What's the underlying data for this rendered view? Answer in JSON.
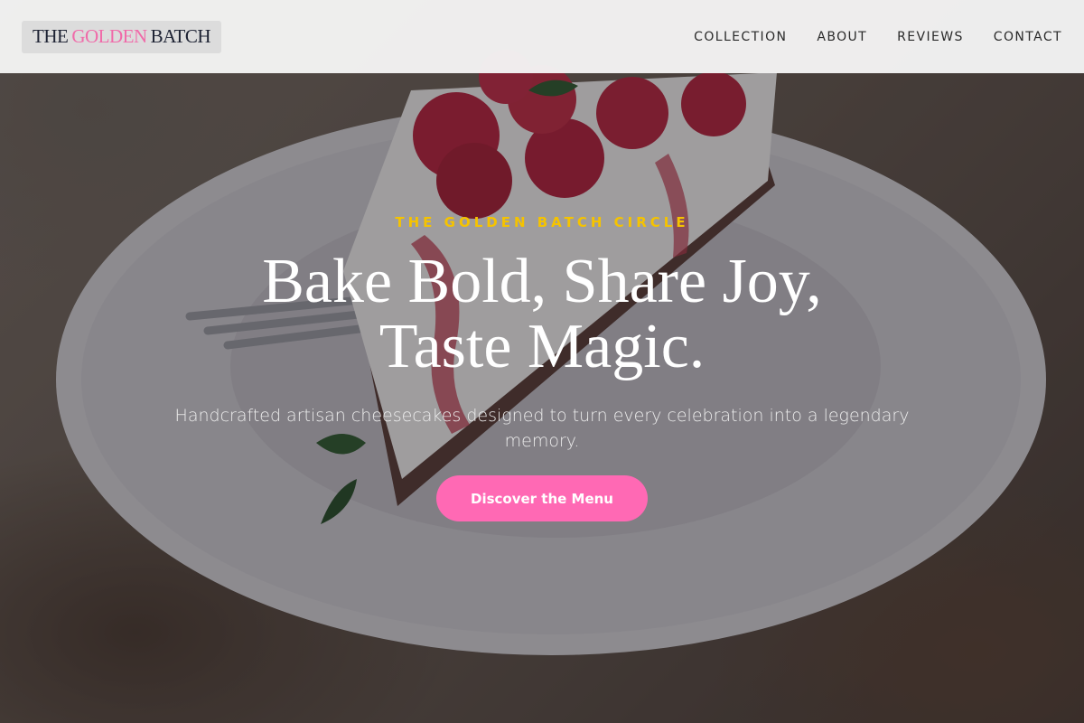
{
  "header": {
    "logo": {
      "part1": "THE",
      "part2": "GOLDEN",
      "part3": "BATCH"
    },
    "nav": [
      {
        "label": "COLLECTION"
      },
      {
        "label": "ABOUT"
      },
      {
        "label": "REVIEWS"
      },
      {
        "label": "CONTACT"
      }
    ]
  },
  "hero": {
    "eyebrow": "THE GOLDEN BATCH CIRCLE",
    "headline_line1": "Bake Bold, Share Joy,",
    "headline_line2": "Taste Magic.",
    "subtitle": "Handcrafted artisan cheesecakes designed to turn every celebration into a legendary memory.",
    "cta_label": "Discover the Menu"
  },
  "colors": {
    "accent_pink": "#ff69b4",
    "logo_pink": "#f06aa9",
    "eyebrow_gold": "#f5c300",
    "header_bg": "#f5f5f5"
  }
}
